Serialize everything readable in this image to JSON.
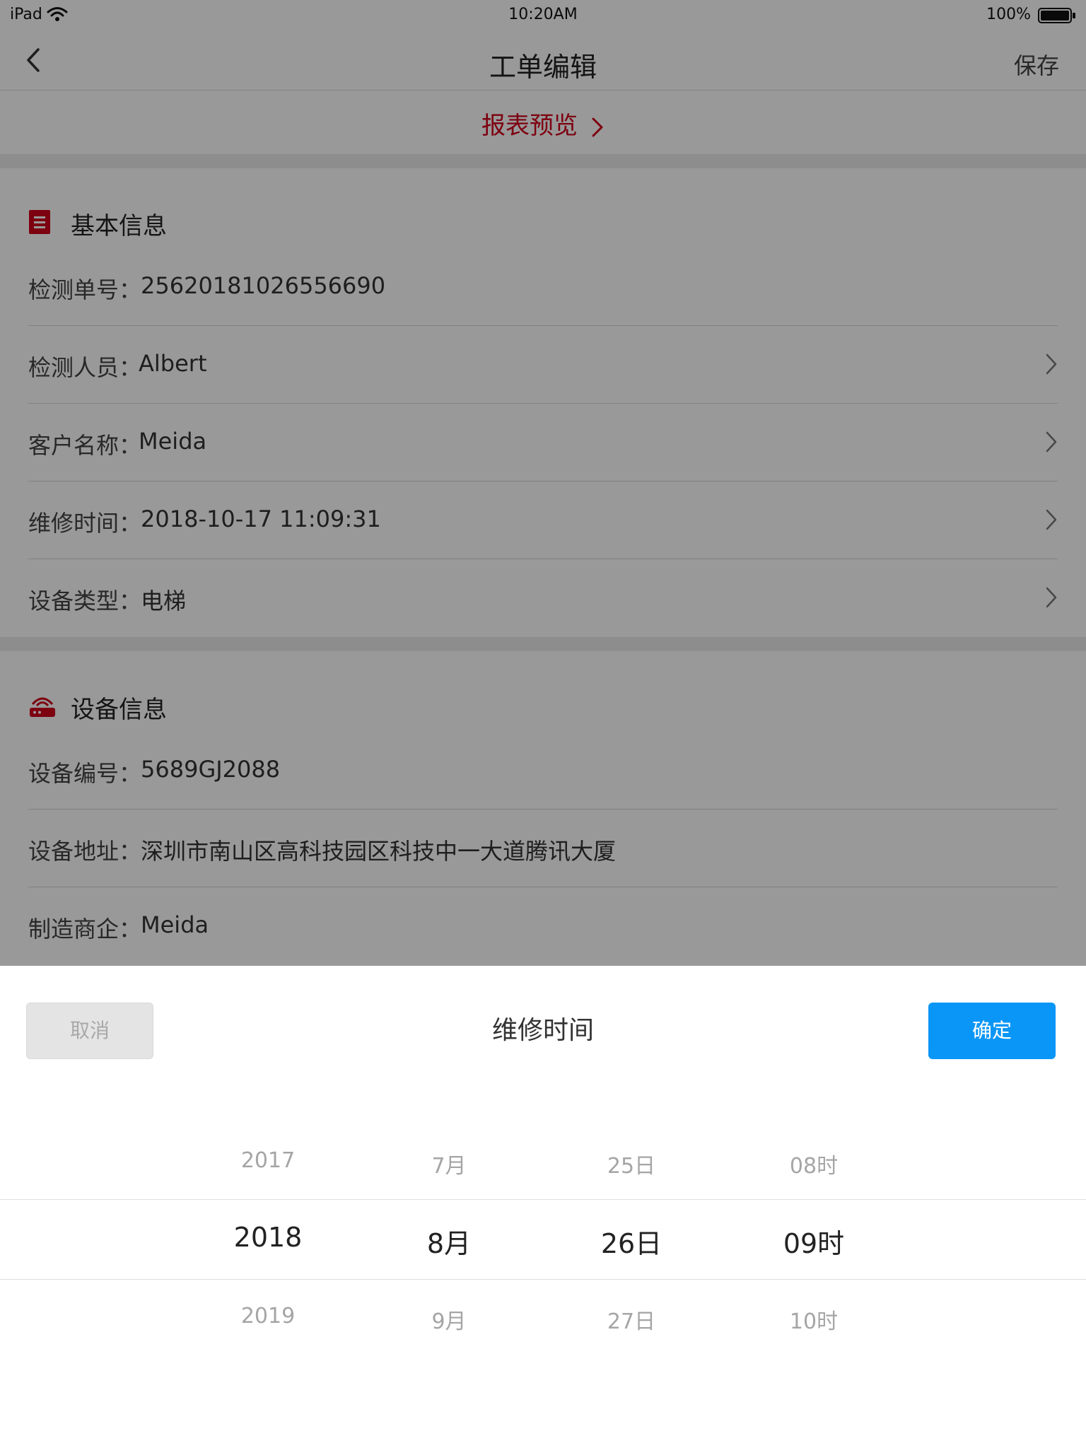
{
  "status_bar": {
    "carrier": "iPad",
    "time": "10:20AM",
    "battery": "100%"
  },
  "nav": {
    "title": "工单编辑",
    "save": "保存",
    "back_icon": "chevron-left-icon"
  },
  "preview": {
    "label": "报表预览",
    "color": "#d0021b"
  },
  "basic_info": {
    "title": "基本信息",
    "icon": "document-list-icon",
    "rows": [
      {
        "label": "检测单号：",
        "value": "25620181026556690",
        "has_chevron": false
      },
      {
        "label": "检测人员：",
        "value": "Albert",
        "has_chevron": true
      },
      {
        "label": "客户名称：",
        "value": "Meida",
        "has_chevron": true
      },
      {
        "label": "维修时间：",
        "value": "2018-10-17 11:09:31",
        "has_chevron": true
      },
      {
        "label": "设备类型：",
        "value": "电梯",
        "has_chevron": true
      }
    ]
  },
  "device_info": {
    "title": "设备信息",
    "icon": "router-icon",
    "rows": [
      {
        "label": "设备编号：",
        "value": "5689GJ2088"
      },
      {
        "label": "设备地址：",
        "value": "深圳市南山区高科技园区科技中一大道腾讯大厦"
      },
      {
        "label": "制造商企：",
        "value": "Meida"
      }
    ]
  },
  "picker": {
    "title": "维修时间",
    "cancel": "取消",
    "confirm": "确定",
    "confirm_color": "#0a96f6",
    "columns": [
      {
        "prev": "2017",
        "selected": "2018",
        "next": "2019"
      },
      {
        "prev": "7月",
        "selected": "8月",
        "next": "9月"
      },
      {
        "prev": "25日",
        "selected": "26日",
        "next": "27日"
      },
      {
        "prev": "08时",
        "selected": "09时",
        "next": "10时"
      }
    ]
  }
}
